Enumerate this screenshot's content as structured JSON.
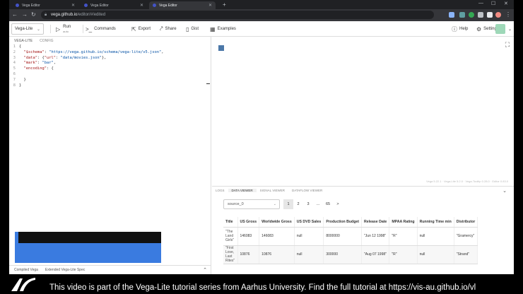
{
  "browser": {
    "tabs": [
      {
        "title": "Vega Editor",
        "active": false
      },
      {
        "title": "Vega Editor",
        "active": false
      },
      {
        "title": "Vega Editor",
        "active": true
      }
    ],
    "new_tab": "+",
    "url_host": "vega.github.io",
    "url_path": "/editor/#/edited"
  },
  "toolbar": {
    "mode": "Vega-Lite",
    "run_label": "Run",
    "run_sub": "auto",
    "commands_label": "Commands",
    "export_label": "Export",
    "share_label": "Share",
    "gist_label": "Gist",
    "examples_label": "Examples",
    "help_label": "Help",
    "settings_label": "Settings"
  },
  "editor": {
    "tabs": [
      "Vega-Lite",
      "Config"
    ],
    "lines": [
      {
        "n": "1",
        "parts": [
          [
            "p",
            "{"
          ]
        ]
      },
      {
        "n": "2",
        "parts": [
          [
            "p",
            "  "
          ],
          [
            "k",
            "\"$schema\""
          ],
          [
            "p",
            ": "
          ],
          [
            "s",
            "\"https://vega.github.io/schema/vega-lite/v5.json\""
          ],
          [
            "p",
            ","
          ]
        ]
      },
      {
        "n": "3",
        "parts": [
          [
            "p",
            "  "
          ],
          [
            "k",
            "\"data\""
          ],
          [
            "p",
            ": {"
          ],
          [
            "k",
            "\"url\""
          ],
          [
            "p",
            ": "
          ],
          [
            "s",
            "\"data/movies.json\""
          ],
          [
            "p",
            "},"
          ]
        ]
      },
      {
        "n": "4",
        "parts": [
          [
            "p",
            "  "
          ],
          [
            "k",
            "\"mark\""
          ],
          [
            "p",
            ": "
          ],
          [
            "s",
            "\"bar\""
          ],
          [
            "p",
            ","
          ]
        ]
      },
      {
        "n": "5",
        "parts": [
          [
            "p",
            "  "
          ],
          [
            "k",
            "\"encoding\""
          ],
          [
            "p",
            ": {"
          ]
        ]
      },
      {
        "n": "6",
        "parts": [
          [
            "p",
            ""
          ]
        ]
      },
      {
        "n": "7",
        "parts": [
          [
            "p",
            "  }"
          ]
        ]
      },
      {
        "n": "8",
        "parts": [
          [
            "p",
            "}"
          ]
        ]
      }
    ],
    "bottom_tabs": [
      "Compiled Vega",
      "Extended Vega-Lite Spec"
    ]
  },
  "output": {
    "version_info": "Vega 5.22.1 · Vega-Lite 5.2.0 · Vega-Tooltip 0.28.0 · Editor 0.83.0",
    "panel_tabs": [
      "Logs",
      "Data Viewer",
      "Signal Viewer",
      "Dataflow Viewer"
    ],
    "active_panel": 1,
    "dataset": "source_0",
    "pages": [
      "1",
      "2",
      "3",
      "...",
      "65",
      ">"
    ],
    "current_page": "1",
    "columns": [
      "Title",
      "US Gross",
      "Worldwide Gross",
      "US DVD Sales",
      "Production Budget",
      "Release Date",
      "MPAA Rating",
      "Running Time min",
      "Distributor"
    ],
    "rows": [
      [
        "\"The Land Girls\"",
        "146083",
        "146083",
        "null",
        "8000000",
        "\"Jun 12 1998\"",
        "\"R\"",
        "null",
        "\"Gramercy\""
      ],
      [
        "\"First Love, Last Rites\"",
        "10876",
        "10876",
        "null",
        "300000",
        "\"Aug 07 1998\"",
        "\"R\"",
        "null",
        "\"Strand\""
      ]
    ]
  },
  "caption": "This video is part of the Vega-Lite tutorial series from Aarhus University. Find the full tutorial at https://vis-au.github.io/vl",
  "colors": {
    "accent": "#4c78a8",
    "bar_blue": "#3a7be0",
    "tab_strip": "#202124"
  }
}
